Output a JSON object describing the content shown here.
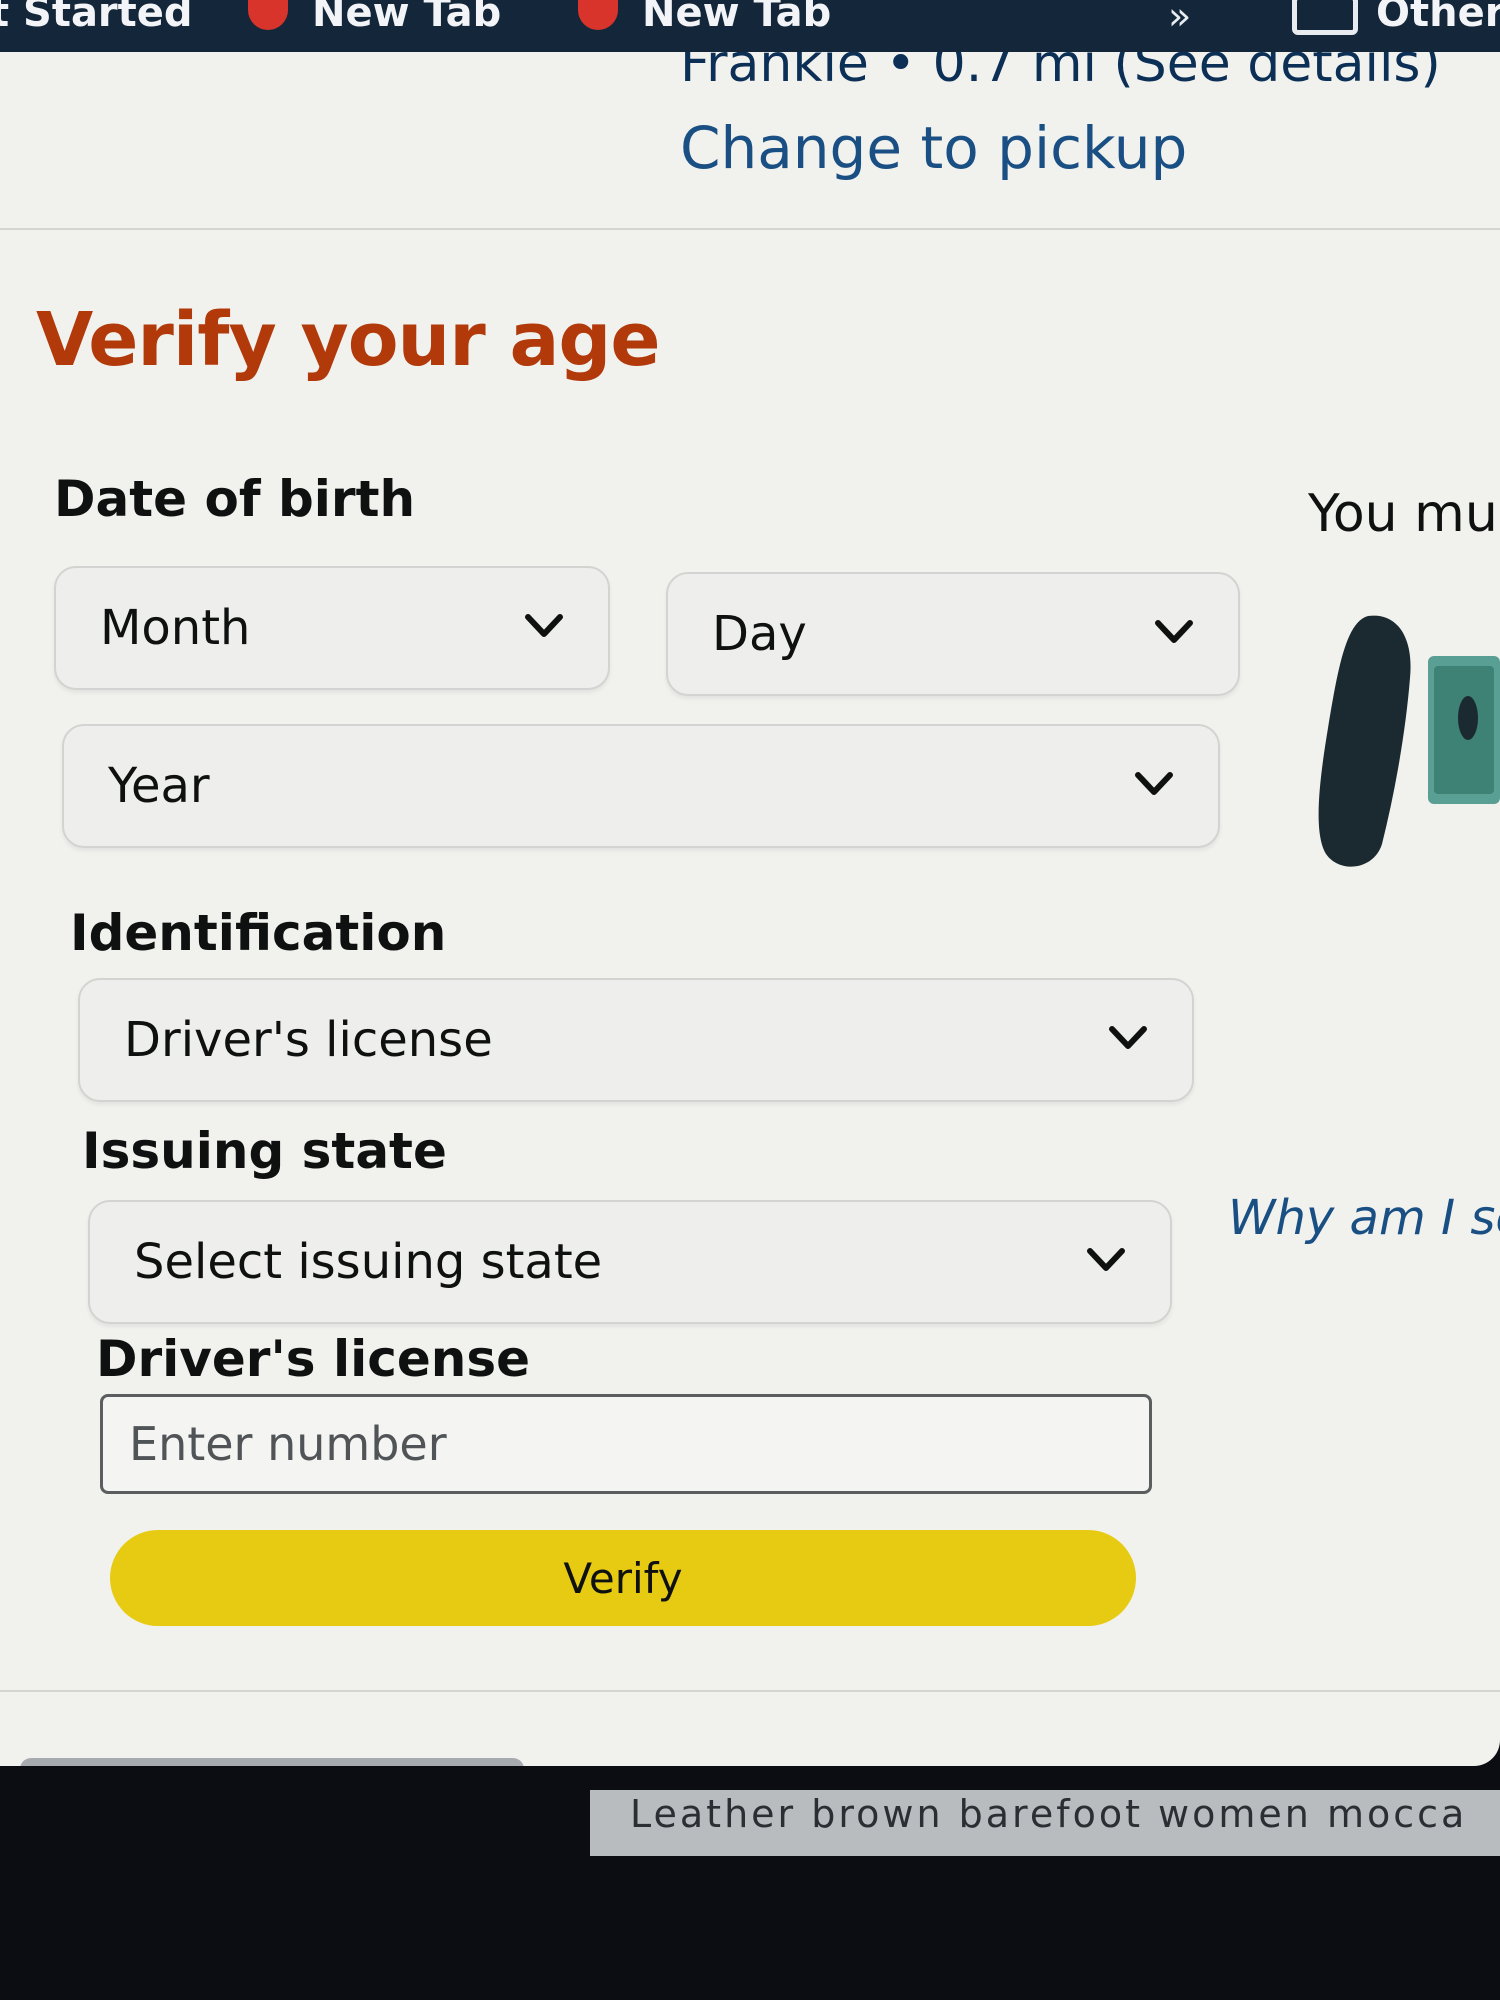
{
  "browser": {
    "tabs": [
      {
        "label": "Get Started"
      },
      {
        "label": "New Tab"
      },
      {
        "label": "New Tab"
      }
    ],
    "bookmarks_overflow": "Other"
  },
  "delivery": {
    "location_text": "Frankie • 0.7 mi (See details)",
    "change_link": "Change to pickup"
  },
  "form": {
    "title": "Verify your age",
    "dob_label": "Date of birth",
    "month": "Month",
    "day": "Day",
    "year": "Year",
    "id_label": "Identification",
    "id_value": "Driver's license",
    "state_label": "Issuing state",
    "state_value": "Select issuing state",
    "license_label": "Driver's license",
    "license_placeholder": "Enter number",
    "verify_label": "Verify"
  },
  "side": {
    "note": "You mu",
    "why_link": "Why am I se"
  },
  "footer": {
    "caption": "Leather brown barefoot women mocca"
  },
  "colors": {
    "title": "#b1390a",
    "link": "#1a4f84",
    "button": "#e6cb12"
  }
}
